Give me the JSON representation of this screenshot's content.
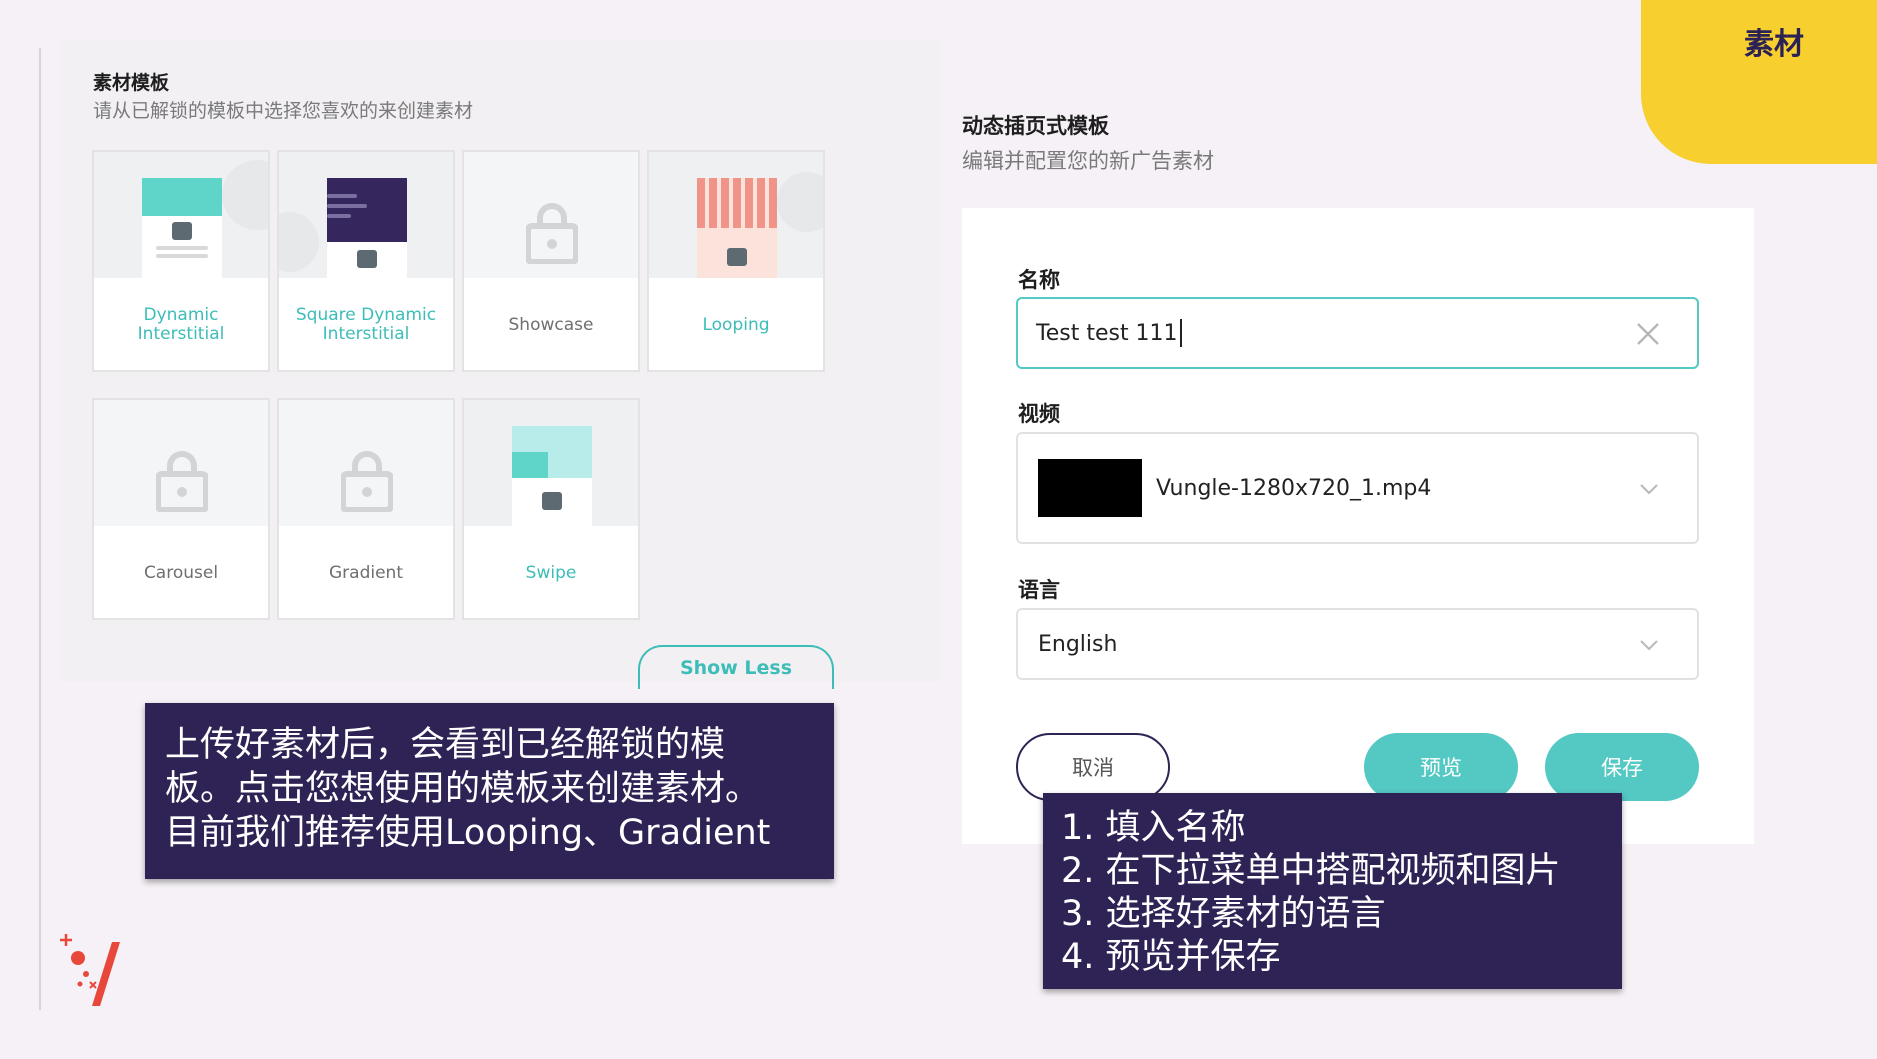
{
  "corner_tag": "素材",
  "templates_panel": {
    "title": "素材模板",
    "subtitle": "请从已解锁的模板中选择您喜欢的来创建素材",
    "cards": [
      {
        "label": "Dynamic Interstitial",
        "locked": false
      },
      {
        "label": "Square Dynamic Interstitial",
        "locked": false
      },
      {
        "label": "Showcase",
        "locked": true
      },
      {
        "label": "Looping",
        "locked": false
      },
      {
        "label": "Carousel",
        "locked": true
      },
      {
        "label": "Gradient",
        "locked": true
      },
      {
        "label": "Swipe",
        "locked": false
      }
    ],
    "show_less": "Show Less"
  },
  "note_left": {
    "lines": [
      "上传好素材后，会看到已经解锁的模",
      "板。点击您想使用的模板来创建素材。",
      "目前我们推荐使用Looping、Gradient"
    ]
  },
  "form": {
    "title": "动态插页式模板",
    "subtitle": "编辑并配置您的新广告素材",
    "name_label": "名称",
    "name_value": "Test test 111",
    "video_label": "视频",
    "video_value": "Vungle-1280x720_1.mp4",
    "language_label": "语言",
    "language_value": "English",
    "cancel": "取消",
    "preview": "预览",
    "save": "保存"
  },
  "note_right": {
    "lines": [
      "1. 填入名称",
      "2. 在下拉菜单中搭配视频和图片",
      "3. 选择好素材的语言",
      "4. 预览并保存"
    ]
  },
  "colors": {
    "accent_teal": "#3dbdb8",
    "note_bg": "#2f2356",
    "corner_yellow": "#f7cf2f"
  }
}
